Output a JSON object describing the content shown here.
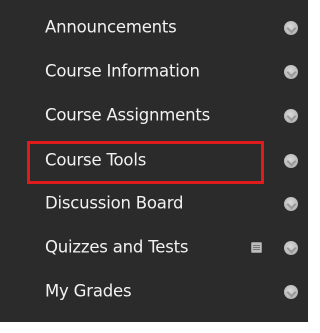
{
  "menu": {
    "items": [
      {
        "label": "Announcements",
        "indicator": "chevron-circle-icon"
      },
      {
        "label": "Course Information",
        "indicator": "chevron-circle-icon"
      },
      {
        "label": "Course Assignments",
        "indicator": "chevron-circle-icon"
      },
      {
        "label": "Course Tools",
        "indicator": "chevron-circle-icon",
        "highlighted": true
      },
      {
        "label": "Discussion Board",
        "indicator": "chevron-circle-icon"
      },
      {
        "label": "Quizzes and Tests",
        "indicator": "chevron-circle-icon",
        "extra_icon": "document-icon"
      },
      {
        "label": "My Grades",
        "indicator": "chevron-circle-icon"
      }
    ]
  },
  "colors": {
    "menu_background": "#2b2b2b",
    "menu_text": "#f2f2f2",
    "highlight_border": "#e01b1b",
    "indicator": "#bdbdbd"
  }
}
